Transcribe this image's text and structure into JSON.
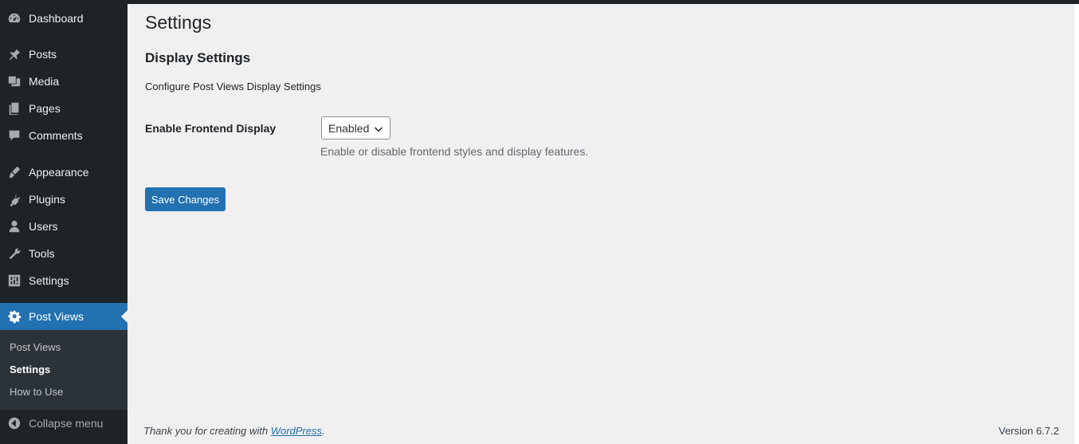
{
  "sidebar": {
    "items": [
      {
        "label": "Dashboard",
        "icon": "dashboard-icon"
      },
      {
        "label": "Posts",
        "icon": "pin-icon"
      },
      {
        "label": "Media",
        "icon": "media-icon"
      },
      {
        "label": "Pages",
        "icon": "pages-icon"
      },
      {
        "label": "Comments",
        "icon": "comments-icon"
      },
      {
        "label": "Appearance",
        "icon": "brush-icon"
      },
      {
        "label": "Plugins",
        "icon": "plugin-icon"
      },
      {
        "label": "Users",
        "icon": "user-icon"
      },
      {
        "label": "Tools",
        "icon": "wrench-icon"
      },
      {
        "label": "Settings",
        "icon": "sliders-icon"
      },
      {
        "label": "Post Views",
        "icon": "gear-icon"
      }
    ],
    "submenu": [
      {
        "label": "Post Views"
      },
      {
        "label": "Settings"
      },
      {
        "label": "How to Use"
      }
    ],
    "collapse_label": "Collapse menu"
  },
  "main": {
    "page_title": "Settings",
    "section_title": "Display Settings",
    "section_description": "Configure Post Views Display Settings",
    "field_label": "Enable Frontend Display",
    "select_value": "Enabled",
    "field_description": "Enable or disable frontend styles and display features.",
    "save_button": "Save Changes"
  },
  "footer": {
    "thanks_text": "Thank you for creating with ",
    "thanks_link": "WordPress",
    "thanks_end": ".",
    "version": "Version 6.7.2"
  },
  "colors": {
    "sidebar_bg": "#1d2327",
    "accent": "#2271b1",
    "submenu_bg": "#2c3338",
    "page_bg": "#f0f0f1"
  }
}
